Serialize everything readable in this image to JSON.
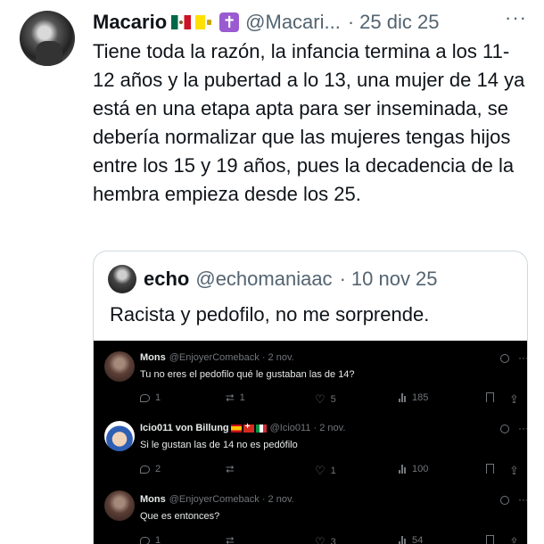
{
  "tweet": {
    "author_name": "Macario",
    "author_handle": "@Macari...",
    "date": "25 dic 25",
    "separator": "·",
    "cross_glyph": "✝",
    "more_glyph": "···",
    "text": "Tiene toda la razón, la infancia termina a los 11-12 años y la pubertad a lo 13, una mujer de 14 ya está en una etapa apta para ser inseminada, se debería normalizar que las mujeres tengas hijos entre los 15 y 19 años, pues la decadencia de la hembra empieza desde los 25."
  },
  "quote": {
    "author_name": "echo",
    "author_handle": "@echomaniaac",
    "date": "10 nov 25",
    "text": "Racista y pedofilo, no me sorprende."
  },
  "embedded_replies": [
    {
      "author_name": "Mons",
      "author_handle": "@EnjoyerComeback · 2 nov.",
      "text": "Tu no eres el pedofilo qué le gustaban las de 14?",
      "replies": "1",
      "reposts": "1",
      "likes": "5",
      "views": "185"
    },
    {
      "author_name": "Icio011 von Billung",
      "author_handle": "@Icio011 · 2 nov.",
      "text": "Si le gustan las de 14 no es pedófilo",
      "replies": "2",
      "reposts": "",
      "likes": "1",
      "views": "100"
    },
    {
      "author_name": "Mons",
      "author_handle": "@EnjoyerComeback · 2 nov.",
      "text": "Que es entonces?",
      "replies": "1",
      "reposts": "",
      "likes": "3",
      "views": "54"
    }
  ],
  "icons": {
    "more": "more-icon",
    "reply": "reply-icon",
    "repost": "repost-icon",
    "like": "heart-icon",
    "views": "views-icon",
    "bookmark": "bookmark-icon",
    "share": "share-icon",
    "grok": "grok-icon"
  },
  "glyphs": {
    "repost": "⮂",
    "heart": "♡",
    "share": "⇪",
    "more": "···"
  }
}
